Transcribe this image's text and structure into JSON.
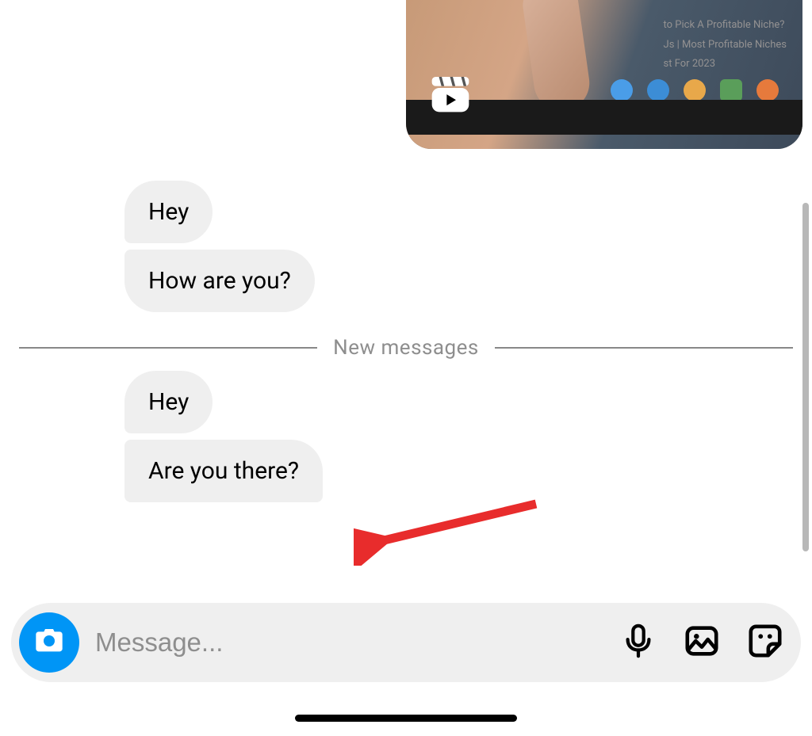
{
  "reel": {
    "text_line1": "to Pick A Profitable Niche?",
    "text_line2": "Js | Most Profitable Niches",
    "text_line3": "st For 2023"
  },
  "messages": {
    "group1": [
      {
        "text": "Hey"
      },
      {
        "text": "How are you?"
      }
    ],
    "divider": "New messages",
    "group2": [
      {
        "text": "Hey"
      },
      {
        "text": "Are you there?"
      }
    ]
  },
  "composer": {
    "placeholder": "Message..."
  }
}
